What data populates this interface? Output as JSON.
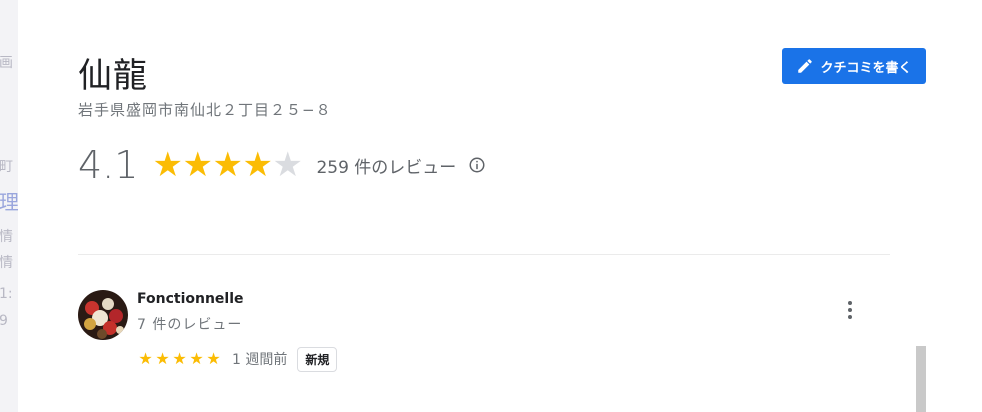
{
  "place": {
    "name": "仙龍",
    "address": "岩手県盛岡市南仙北２丁目２５−８"
  },
  "write_review_button": {
    "label": "クチコミを書く",
    "icon": "pencil-icon"
  },
  "rating": {
    "value": "4.1",
    "stars_filled": 4,
    "stars_total": 5,
    "review_count_text": "259 件のレビュー",
    "info_icon": "info-icon"
  },
  "reviews": [
    {
      "author": "Fonctionnelle",
      "author_reviews": "7 件のレビュー",
      "stars": 5,
      "date": "1 週間前",
      "badge": "新規",
      "more_icon": "more-vert-icon"
    }
  ],
  "background_page": {
    "fragments": [
      "画",
      "町",
      "理",
      "情",
      "情",
      "1:",
      "9"
    ]
  },
  "colors": {
    "accent": "#1a73e8",
    "star": "#fbbc04",
    "star_empty": "#dadce0"
  }
}
